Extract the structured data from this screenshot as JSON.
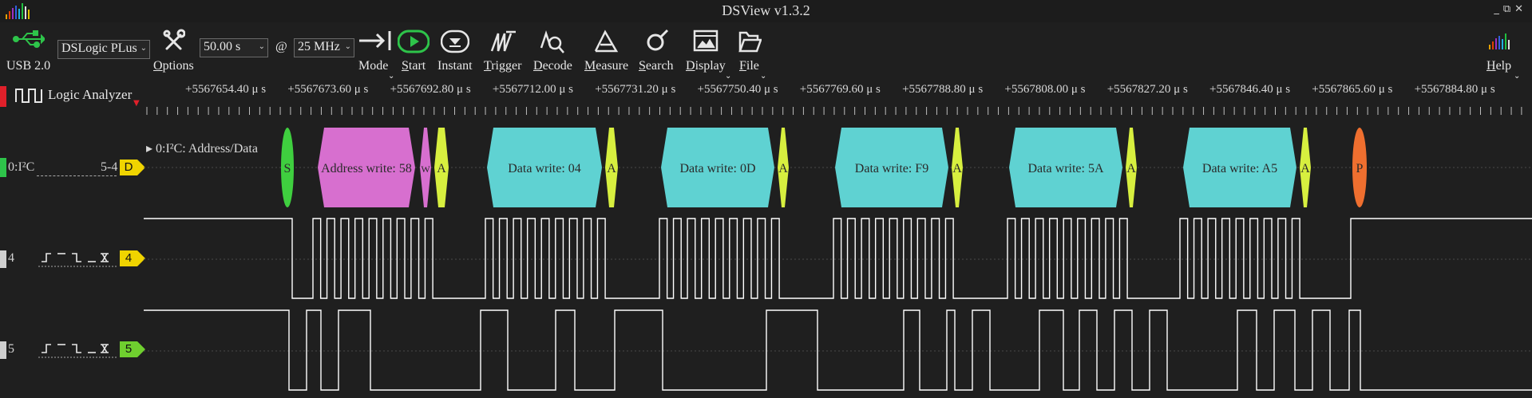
{
  "window": {
    "title": "DSView v1.3.2",
    "controls": "_⧉✕"
  },
  "toolbar": {
    "usb_label": "USB 2.0",
    "device_select": "DSLogic PLus",
    "options_label": "Options",
    "duration_select": "50.00 s",
    "at_symbol": "@",
    "rate_select": "25 MHz",
    "mode_label": "Mode",
    "start_label": "Start",
    "instant_label": "Instant",
    "trigger_label": "Trigger",
    "decode_label": "Decode",
    "measure_label": "Measure",
    "search_label": "Search",
    "display_label": "Display",
    "file_label": "File",
    "help_label": "Help",
    "icons": [
      "usb-icon",
      "options-icon",
      "mode-icon",
      "start-icon",
      "instant-icon",
      "trigger-icon",
      "decode-icon",
      "measure-icon",
      "search-icon",
      "display-icon",
      "file-icon",
      "help-icon"
    ],
    "accent": "#2ec44a"
  },
  "view": {
    "mode_name": "Logic Analyzer"
  },
  "ruler": {
    "ticks": [
      "+5567654.40 μ s",
      "+5567673.60 μ s",
      "+5567692.80 μ s",
      "+5567712.00 μ s",
      "+5567731.20 μ s",
      "+5567750.40 μ s",
      "+5567769.60 μ s",
      "+5567788.80 μ s",
      "+5567808.00 μ s",
      "+5567827.20 μ s",
      "+5567846.40 μ s",
      "+5567865.60 μ s",
      "+5567884.80 μ s"
    ]
  },
  "decoder": {
    "name": "0:I²C",
    "pins": "5-4",
    "tag": "D",
    "row_label": "0:I²C: Address/Data",
    "segments": [
      {
        "text": "S",
        "kind": "start",
        "color": "#3fcf3f"
      },
      {
        "text": "Address write: 58",
        "kind": "address",
        "color": "#d76fcf"
      },
      {
        "text": "W",
        "kind": "rw",
        "color": "#d76fcf"
      },
      {
        "text": "A",
        "kind": "ack",
        "color": "#d7ef3f"
      },
      {
        "text": "Data write: 04",
        "kind": "data",
        "color": "#5fd2d2"
      },
      {
        "text": "A",
        "kind": "ack",
        "color": "#d7ef3f"
      },
      {
        "text": "Data write: 0D",
        "kind": "data",
        "color": "#5fd2d2"
      },
      {
        "text": "A",
        "kind": "ack",
        "color": "#d7ef3f"
      },
      {
        "text": "Data write: F9",
        "kind": "data",
        "color": "#5fd2d2"
      },
      {
        "text": "A",
        "kind": "ack",
        "color": "#d7ef3f"
      },
      {
        "text": "Data write: 5A",
        "kind": "data",
        "color": "#5fd2d2"
      },
      {
        "text": "A",
        "kind": "ack",
        "color": "#d7ef3f"
      },
      {
        "text": "Data write: A5",
        "kind": "data",
        "color": "#5fd2d2"
      },
      {
        "text": "A",
        "kind": "ack",
        "color": "#d7ef3f"
      },
      {
        "text": "P",
        "kind": "stop",
        "color": "#ef6f2f"
      }
    ]
  },
  "channels": [
    {
      "label": "4",
      "tag": "4",
      "tag_color": "#f0d400",
      "mark_color": "#cfcfcf"
    },
    {
      "label": "5",
      "tag": "5",
      "tag_color": "#6fcf2f",
      "mark_color": "#cfcfcf"
    }
  ],
  "colors": {
    "decoder_mark": "#2ec44a",
    "view_mark": "#e0202a",
    "wave": "#ffffff"
  }
}
